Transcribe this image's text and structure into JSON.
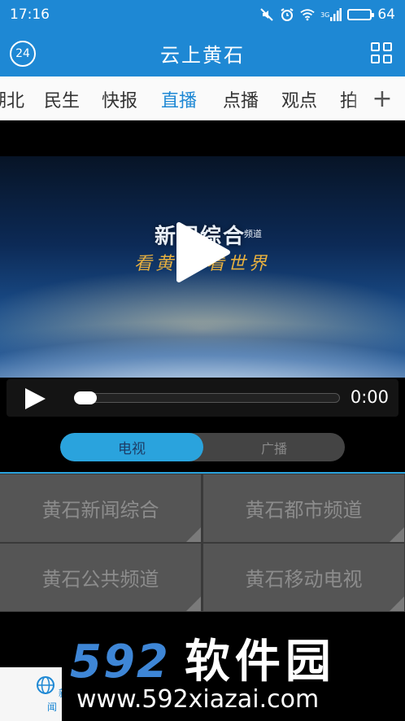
{
  "status_bar": {
    "time": "17:16",
    "network": "3G",
    "battery": "64",
    "battery_level_percent": 64
  },
  "header": {
    "title": "云上黄石",
    "badge": "24"
  },
  "categories": [
    {
      "label": "湖北",
      "active": false
    },
    {
      "label": "民生",
      "active": false
    },
    {
      "label": "快报",
      "active": false
    },
    {
      "label": "直播",
      "active": true
    },
    {
      "label": "点播",
      "active": false
    },
    {
      "label": "观点",
      "active": false
    },
    {
      "label": "拍",
      "active": false
    }
  ],
  "categories_add": "+",
  "player": {
    "overlay_title": "新闻综合",
    "overlay_sub": "频道",
    "overlay_slogan": "看黄石 看世界",
    "time": "0:00",
    "progress_fraction": 0
  },
  "toggle": {
    "tv": "电视",
    "radio": "广播",
    "selected": "电视"
  },
  "channels": [
    {
      "label": "黄石新闻综合"
    },
    {
      "label": "黄石都市频道"
    },
    {
      "label": "黄石公共频道"
    },
    {
      "label": "黄石移动电视"
    }
  ],
  "bottom_nav": {
    "news": "新闻"
  },
  "watermark": {
    "logo_num": "592",
    "logo_cn": "软件园",
    "url": "www.592xiazai.com"
  },
  "colors": {
    "primary": "#1e88d4",
    "toggle_active": "#2aa3dd",
    "channel_tile": "#555555"
  },
  "icons": [
    "mute-icon",
    "alarm-icon",
    "wifi-icon",
    "signal-icon",
    "battery-icon",
    "grid-icon",
    "play-icon",
    "globe-icon"
  ]
}
